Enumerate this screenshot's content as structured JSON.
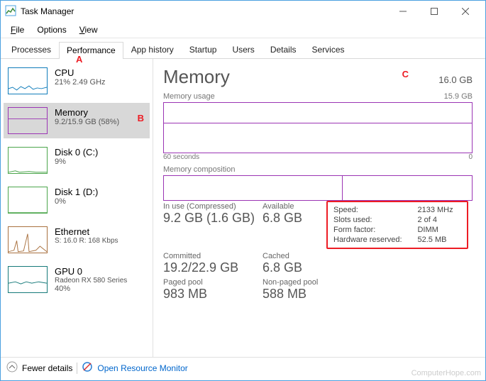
{
  "window": {
    "title": "Task Manager"
  },
  "menu": {
    "file": "File",
    "options": "Options",
    "view": "View"
  },
  "tabs": {
    "processes": "Processes",
    "performance": "Performance",
    "app_history": "App history",
    "startup": "Startup",
    "users": "Users",
    "details": "Details",
    "services": "Services"
  },
  "annotations": {
    "a": "A",
    "b": "B",
    "c": "C"
  },
  "sidebar": {
    "cpu": {
      "title": "CPU",
      "sub": "21% 2.49 GHz"
    },
    "memory": {
      "title": "Memory",
      "sub": "9.2/15.9 GB (58%)"
    },
    "disk0": {
      "title": "Disk 0 (C:)",
      "sub": "9%"
    },
    "disk1": {
      "title": "Disk 1 (D:)",
      "sub": "0%"
    },
    "ethernet": {
      "title": "Ethernet",
      "sub": "S: 16.0 R: 168 Kbps"
    },
    "gpu": {
      "title": "GPU 0",
      "sub": "Radeon RX 580 Series",
      "sub2": "40%"
    }
  },
  "main": {
    "heading": "Memory",
    "capacity": "16.0 GB",
    "usage_label": "Memory usage",
    "usage_max": "15.9 GB",
    "axis_left": "60 seconds",
    "axis_right": "0",
    "comp_label": "Memory composition",
    "stats": {
      "inuse_lbl": "In use (Compressed)",
      "inuse_val": "9.2 GB (1.6 GB)",
      "avail_lbl": "Available",
      "avail_val": "6.8 GB",
      "committed_lbl": "Committed",
      "committed_val": "19.2/22.9 GB",
      "cached_lbl": "Cached",
      "cached_val": "6.8 GB",
      "paged_lbl": "Paged pool",
      "paged_val": "983 MB",
      "nonpaged_lbl": "Non-paged pool",
      "nonpaged_val": "588 MB"
    },
    "specs": {
      "speed_lbl": "Speed:",
      "speed_val": "2133 MHz",
      "slots_lbl": "Slots used:",
      "slots_val": "2 of 4",
      "form_lbl": "Form factor:",
      "form_val": "DIMM",
      "hw_lbl": "Hardware reserved:",
      "hw_val": "52.5 MB"
    }
  },
  "footer": {
    "fewer": "Fewer details",
    "monitor": "Open Resource Monitor"
  },
  "watermark": "ComputerHope.com"
}
